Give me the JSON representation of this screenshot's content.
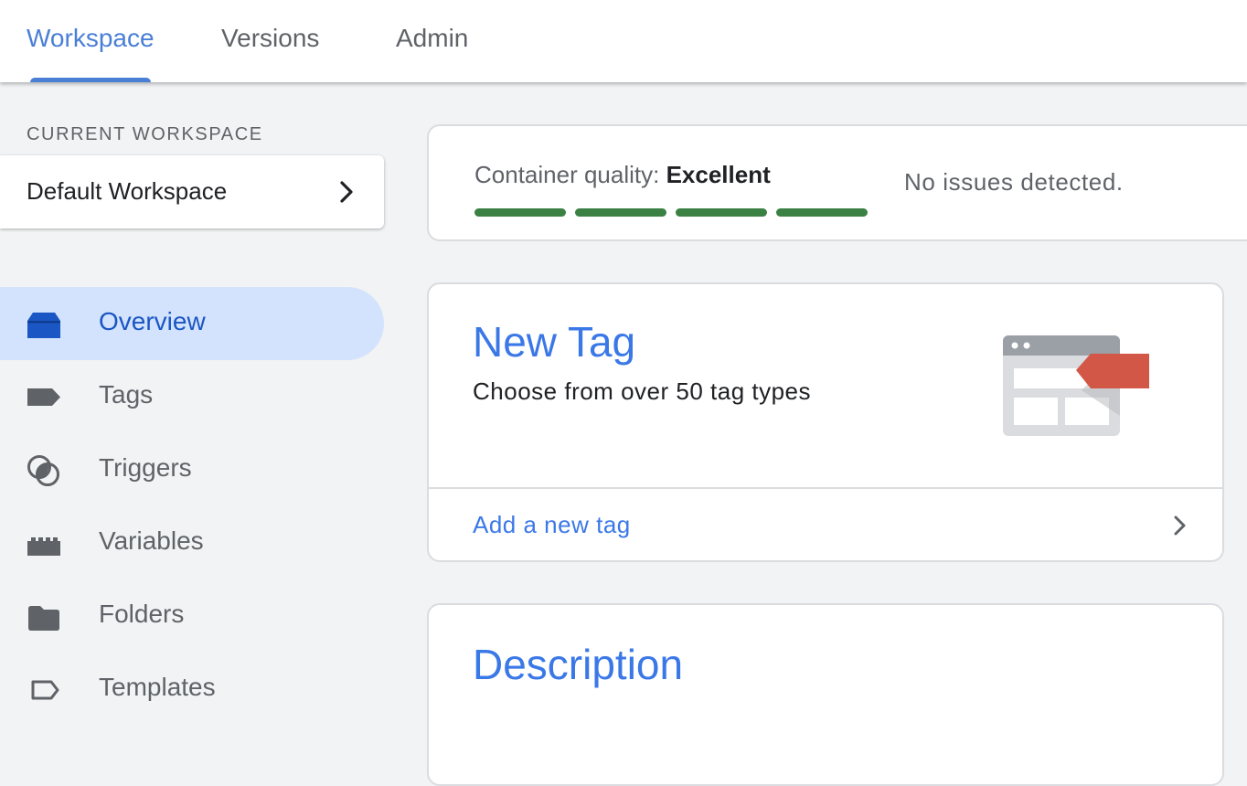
{
  "tabs": [
    {
      "label": "Workspace",
      "active": true
    },
    {
      "label": "Versions",
      "active": false
    },
    {
      "label": "Admin",
      "active": false
    }
  ],
  "sidebar": {
    "section_label": "CURRENT WORKSPACE",
    "workspace_name": "Default Workspace",
    "items": [
      {
        "label": "Overview",
        "icon": "overview-icon",
        "active": true
      },
      {
        "label": "Tags",
        "icon": "tag-icon",
        "active": false
      },
      {
        "label": "Triggers",
        "icon": "triggers-icon",
        "active": false
      },
      {
        "label": "Variables",
        "icon": "variables-icon",
        "active": false
      },
      {
        "label": "Folders",
        "icon": "folder-icon",
        "active": false
      },
      {
        "label": "Templates",
        "icon": "templates-icon",
        "active": false
      }
    ]
  },
  "quality": {
    "label": "Container quality:",
    "value": "Excellent",
    "segments_filled": 4,
    "segments_total": 4,
    "status": "No issues detected."
  },
  "new_tag": {
    "title": "New Tag",
    "subtitle": "Choose from over 50 tag types",
    "link": "Add a new tag"
  },
  "description": {
    "title": "Description"
  },
  "colors": {
    "accent": "#4a7fd6",
    "link": "#3b78e7",
    "quality_bar": "#3a8143",
    "active_nav_bg": "#d3e3fd",
    "tag_red": "#d35746"
  }
}
